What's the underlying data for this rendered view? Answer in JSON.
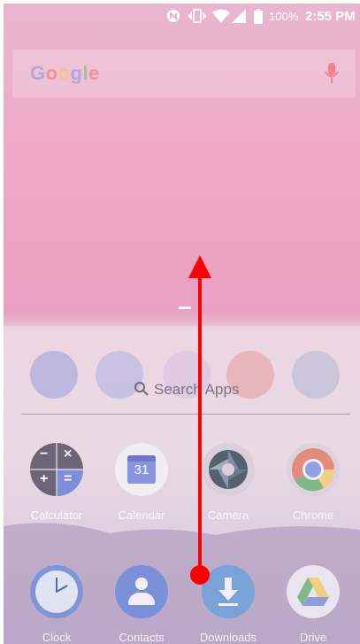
{
  "status_bar": {
    "battery_percent": "100%",
    "time": "2:55 PM",
    "icons": [
      "nfc-icon",
      "vibrate-icon",
      "wifi-icon",
      "cell-signal-icon",
      "battery-icon"
    ]
  },
  "search_bar": {
    "logo": "Google",
    "icons": [
      "mic-icon"
    ]
  },
  "app_drawer": {
    "search_placeholder": "Search Apps",
    "apps_row1": [
      {
        "label": "Calculator",
        "icon": "calculator-icon"
      },
      {
        "label": "Calendar",
        "icon": "calendar-icon",
        "day": "31"
      },
      {
        "label": "Camera",
        "icon": "camera-icon"
      },
      {
        "label": "Chrome",
        "icon": "chrome-icon"
      }
    ],
    "apps_row2": [
      {
        "label": "Clock",
        "icon": "clock-icon"
      },
      {
        "label": "Contacts",
        "icon": "contacts-icon"
      },
      {
        "label": "Downloads",
        "icon": "downloads-icon"
      },
      {
        "label": "Drive",
        "icon": "drive-icon"
      }
    ]
  },
  "gesture": {
    "type": "swipe-up",
    "color": "#ff0000"
  },
  "colors": {
    "wallpaper_top": "#f0a9c6",
    "drawer_overlay": "#f0e1eb",
    "gesture": "#ff0000"
  }
}
